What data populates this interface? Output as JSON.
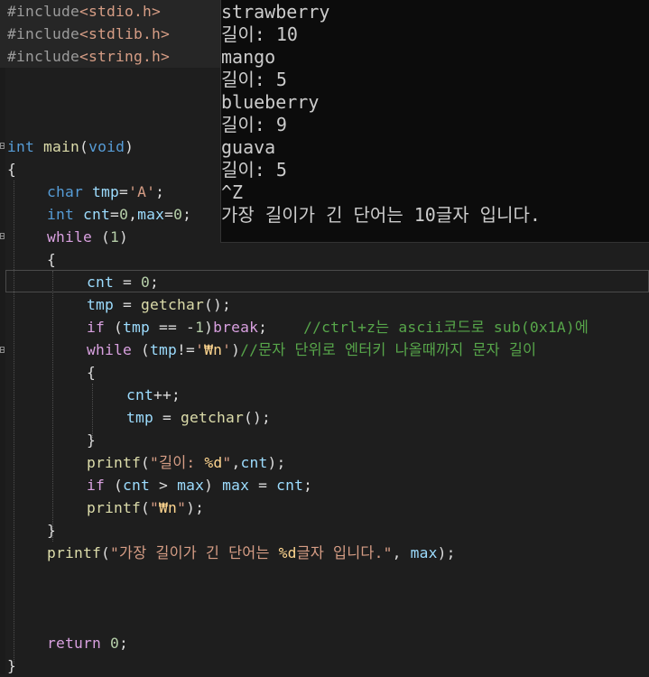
{
  "editor": {
    "lines": [
      {
        "row": 0,
        "indent": 0,
        "tokens": [
          [
            "pp",
            "#include"
          ],
          [
            "pl",
            "<stdio.h>"
          ]
        ]
      },
      {
        "row": 1,
        "indent": 0,
        "tokens": [
          [
            "pp",
            "#include"
          ],
          [
            "pl",
            "<stdlib.h>"
          ]
        ]
      },
      {
        "row": 2,
        "indent": 0,
        "tokens": [
          [
            "pp",
            "#include"
          ],
          [
            "pl",
            "<string.h>"
          ]
        ]
      },
      {
        "row": 6,
        "indent": 0,
        "tokens": [
          [
            "kw",
            "int"
          ],
          [
            "t",
            " "
          ],
          [
            "fn",
            "main"
          ],
          [
            "t",
            "("
          ],
          [
            "kw",
            "void"
          ],
          [
            "t",
            ")"
          ]
        ]
      },
      {
        "row": 7,
        "indent": 0,
        "tokens": [
          [
            "t",
            "{"
          ]
        ]
      },
      {
        "row": 8,
        "indent": 1,
        "tokens": [
          [
            "kw",
            "char"
          ],
          [
            "t",
            " "
          ],
          [
            "id",
            "tmp"
          ],
          [
            "t",
            "="
          ],
          [
            "str",
            "'A'"
          ],
          [
            "t",
            ";"
          ]
        ]
      },
      {
        "row": 9,
        "indent": 1,
        "tokens": [
          [
            "kw",
            "int"
          ],
          [
            "t",
            " "
          ],
          [
            "id",
            "cnt"
          ],
          [
            "t",
            "="
          ],
          [
            "num",
            "0"
          ],
          [
            "t",
            ","
          ],
          [
            "id",
            "max"
          ],
          [
            "t",
            "="
          ],
          [
            "num",
            "0"
          ],
          [
            "t",
            ";"
          ]
        ]
      },
      {
        "row": 10,
        "indent": 1,
        "tokens": [
          [
            "kw2",
            "while"
          ],
          [
            "t",
            " ("
          ],
          [
            "num",
            "1"
          ],
          [
            "t",
            ")"
          ]
        ]
      },
      {
        "row": 11,
        "indent": 1,
        "tokens": [
          [
            "t",
            "{"
          ]
        ]
      },
      {
        "row": 12,
        "indent": 2,
        "tokens": [
          [
            "id",
            "cnt"
          ],
          [
            "t",
            " = "
          ],
          [
            "num",
            "0"
          ],
          [
            "t",
            ";"
          ]
        ]
      },
      {
        "row": 13,
        "indent": 2,
        "tokens": [
          [
            "id",
            "tmp"
          ],
          [
            "t",
            " = "
          ],
          [
            "fn",
            "getchar"
          ],
          [
            "t",
            "();"
          ]
        ]
      },
      {
        "row": 14,
        "indent": 2,
        "tokens": [
          [
            "kw2",
            "if"
          ],
          [
            "t",
            " ("
          ],
          [
            "id",
            "tmp"
          ],
          [
            "t",
            " == -"
          ],
          [
            "num",
            "1"
          ],
          [
            "t",
            ")"
          ],
          [
            "kw2",
            "break"
          ],
          [
            "t",
            ";    "
          ],
          [
            "cmt",
            "//ctrl+z는 ascii코드로 sub(0x1A)에"
          ]
        ]
      },
      {
        "row": 15,
        "indent": 2,
        "tokens": [
          [
            "kw2",
            "while"
          ],
          [
            "t",
            " ("
          ],
          [
            "id",
            "tmp"
          ],
          [
            "t",
            "!="
          ],
          [
            "str",
            "'"
          ],
          [
            "esc",
            "₩n"
          ],
          [
            "str",
            "'"
          ],
          [
            "t",
            ")"
          ],
          [
            "cmt",
            "//문자 단위로 엔터키 나올때까지 문자 길이"
          ]
        ]
      },
      {
        "row": 16,
        "indent": 2,
        "tokens": [
          [
            "t",
            "{"
          ]
        ]
      },
      {
        "row": 17,
        "indent": 3,
        "tokens": [
          [
            "id",
            "cnt"
          ],
          [
            "t",
            "++;"
          ]
        ]
      },
      {
        "row": 18,
        "indent": 3,
        "tokens": [
          [
            "id",
            "tmp"
          ],
          [
            "t",
            " = "
          ],
          [
            "fn",
            "getchar"
          ],
          [
            "t",
            "();"
          ]
        ]
      },
      {
        "row": 19,
        "indent": 2,
        "tokens": [
          [
            "t",
            "}"
          ]
        ]
      },
      {
        "row": 20,
        "indent": 2,
        "tokens": [
          [
            "fn",
            "printf"
          ],
          [
            "t",
            "("
          ],
          [
            "str",
            "\"길이: "
          ],
          [
            "fmt",
            "%d"
          ],
          [
            "str",
            "\""
          ],
          [
            "t",
            ","
          ],
          [
            "id",
            "cnt"
          ],
          [
            "t",
            ");"
          ]
        ]
      },
      {
        "row": 21,
        "indent": 2,
        "tokens": [
          [
            "kw2",
            "if"
          ],
          [
            "t",
            " ("
          ],
          [
            "id",
            "cnt"
          ],
          [
            "t",
            " > "
          ],
          [
            "id",
            "max"
          ],
          [
            "t",
            ") "
          ],
          [
            "id",
            "max"
          ],
          [
            "t",
            " = "
          ],
          [
            "id",
            "cnt"
          ],
          [
            "t",
            ";"
          ]
        ]
      },
      {
        "row": 22,
        "indent": 2,
        "tokens": [
          [
            "fn",
            "printf"
          ],
          [
            "t",
            "("
          ],
          [
            "str",
            "\""
          ],
          [
            "esc",
            "₩n"
          ],
          [
            "str",
            "\""
          ],
          [
            "t",
            ");"
          ]
        ]
      },
      {
        "row": 23,
        "indent": 1,
        "tokens": [
          [
            "t",
            "}"
          ]
        ]
      },
      {
        "row": 24,
        "indent": 1,
        "tokens": [
          [
            "fn",
            "printf"
          ],
          [
            "t",
            "("
          ],
          [
            "str",
            "\"가장 길이가 긴 단어는 "
          ],
          [
            "fmt",
            "%d"
          ],
          [
            "str",
            "글자 입니다.\""
          ],
          [
            "t",
            ", "
          ],
          [
            "id",
            "max"
          ],
          [
            "t",
            ");"
          ]
        ]
      },
      {
        "row": 28,
        "indent": 1,
        "tokens": [
          [
            "kw2",
            "return"
          ],
          [
            "t",
            " "
          ],
          [
            "num",
            "0"
          ],
          [
            "t",
            ";"
          ]
        ]
      },
      {
        "row": 29,
        "indent": 0,
        "tokens": [
          [
            "t",
            "}"
          ]
        ]
      }
    ]
  },
  "console": {
    "lines": [
      "strawberry",
      "길이: 10",
      "mango",
      "길이: 5",
      "blueberry",
      "길이: 9",
      "guava",
      "길이: 5",
      "^Z",
      "가장 길이가 긴 단어는 10글자 입니다."
    ]
  }
}
